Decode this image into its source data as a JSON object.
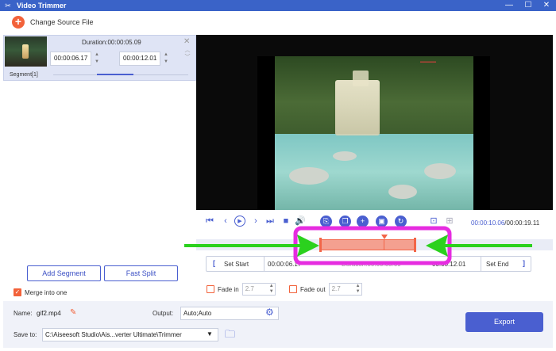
{
  "window": {
    "title": "Video Trimmer",
    "logo": "✂"
  },
  "source": {
    "change_label": "Change Source File"
  },
  "segment": {
    "duration": "Duration:00:00:05.09",
    "start": "00:00:06.17",
    "end": "00:00:12.01",
    "label": "Segment[1]"
  },
  "left_buttons": {
    "add_segment": "Add Segment",
    "fast_split": "Fast Split"
  },
  "merge": {
    "label": "Merge into one",
    "checked": true
  },
  "playback": {
    "current": "00:00:10.06",
    "total": "/00:00:19.11"
  },
  "trim": {
    "set_start": "Set Start",
    "start": "00:00:06.17",
    "duration": "Duration:00:00:05.09",
    "end": "00:00:12.01",
    "set_end": "Set End"
  },
  "fade": {
    "in_label": "Fade in",
    "in_value": "2.7",
    "out_label": "Fade out",
    "out_value": "2.7"
  },
  "bottom": {
    "name_label": "Name:",
    "name_value": "gif2.mp4",
    "output_label": "Output:",
    "output_value": "Auto;Auto",
    "save_label": "Save to:",
    "save_value": "C:\\Aiseesoft Studio\\Ais...verter Ultimate\\Trimmer",
    "export_label": "Export"
  },
  "colors": {
    "accent": "#4a5fd0",
    "orange": "#f2623a",
    "annotation_box": "#e62ce0",
    "annotation_arrow": "#2bd11e"
  }
}
